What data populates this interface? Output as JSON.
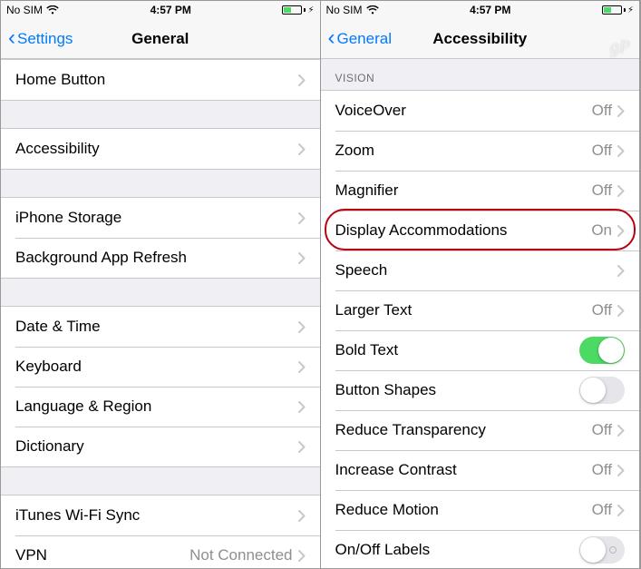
{
  "status": {
    "carrier": "No SIM",
    "time": "4:57 PM"
  },
  "left": {
    "back_label": "Settings",
    "title": "General",
    "groups": [
      {
        "items": [
          {
            "label": "Home Button",
            "value": "",
            "control": "disclosure"
          }
        ]
      },
      {
        "items": [
          {
            "label": "Accessibility",
            "value": "",
            "control": "disclosure"
          }
        ]
      },
      {
        "items": [
          {
            "label": "iPhone Storage",
            "value": "",
            "control": "disclosure"
          },
          {
            "label": "Background App Refresh",
            "value": "",
            "control": "disclosure"
          }
        ]
      },
      {
        "items": [
          {
            "label": "Date & Time",
            "value": "",
            "control": "disclosure"
          },
          {
            "label": "Keyboard",
            "value": "",
            "control": "disclosure"
          },
          {
            "label": "Language & Region",
            "value": "",
            "control": "disclosure"
          },
          {
            "label": "Dictionary",
            "value": "",
            "control": "disclosure"
          }
        ]
      },
      {
        "items": [
          {
            "label": "iTunes Wi-Fi Sync",
            "value": "",
            "control": "disclosure"
          },
          {
            "label": "VPN",
            "value": "Not Connected",
            "control": "disclosure"
          }
        ]
      }
    ]
  },
  "right": {
    "back_label": "General",
    "title": "Accessibility",
    "section_header": "Vision",
    "items": [
      {
        "label": "VoiceOver",
        "value": "Off",
        "control": "disclosure"
      },
      {
        "label": "Zoom",
        "value": "Off",
        "control": "disclosure"
      },
      {
        "label": "Magnifier",
        "value": "Off",
        "control": "disclosure"
      },
      {
        "label": "Display Accommodations",
        "value": "On",
        "control": "disclosure",
        "highlight": true
      },
      {
        "label": "Speech",
        "value": "",
        "control": "disclosure"
      },
      {
        "label": "Larger Text",
        "value": "Off",
        "control": "disclosure"
      },
      {
        "label": "Bold Text",
        "value": "",
        "control": "toggle",
        "toggle_on": true
      },
      {
        "label": "Button Shapes",
        "value": "",
        "control": "toggle",
        "toggle_on": false
      },
      {
        "label": "Reduce Transparency",
        "value": "Off",
        "control": "disclosure"
      },
      {
        "label": "Increase Contrast",
        "value": "Off",
        "control": "disclosure"
      },
      {
        "label": "Reduce Motion",
        "value": "Off",
        "control": "disclosure"
      },
      {
        "label": "On/Off Labels",
        "value": "",
        "control": "toggle",
        "toggle_on": false,
        "labels": true
      }
    ]
  },
  "watermark": "gP"
}
